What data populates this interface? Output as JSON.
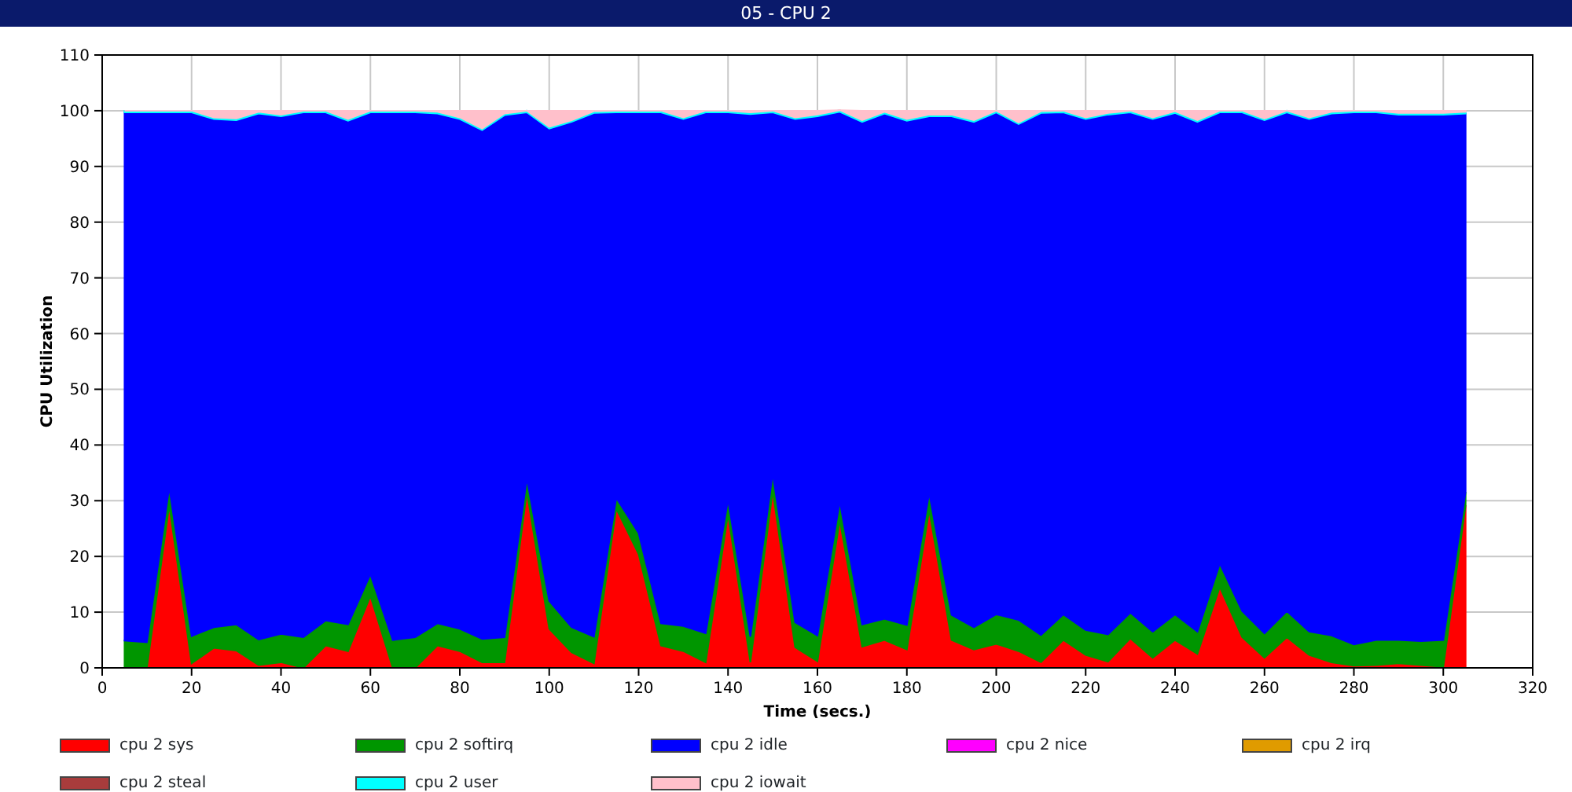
{
  "window": {
    "title": "05 - CPU 2"
  },
  "chart": {
    "chart_data": {
      "type": "area",
      "stacked": true,
      "grid": true,
      "xlabel": "Time (secs.)",
      "ylabel": "CPU Utilization",
      "x": [
        5,
        10,
        15,
        20,
        25,
        30,
        35,
        40,
        45,
        50,
        55,
        60,
        65,
        70,
        75,
        80,
        85,
        90,
        95,
        100,
        105,
        110,
        115,
        120,
        125,
        130,
        135,
        140,
        145,
        150,
        155,
        160,
        165,
        170,
        175,
        180,
        185,
        190,
        195,
        200,
        205,
        210,
        215,
        220,
        225,
        230,
        235,
        240,
        245,
        250,
        255,
        260,
        265,
        270,
        275,
        280,
        285,
        290,
        295,
        300,
        305
      ],
      "xlim": [
        0,
        320
      ],
      "ylim": [
        0,
        110
      ],
      "xticks": [
        0,
        20,
        40,
        60,
        80,
        100,
        120,
        140,
        160,
        180,
        200,
        220,
        240,
        260,
        280,
        300,
        320
      ],
      "yticks": [
        0,
        10,
        20,
        30,
        40,
        50,
        60,
        70,
        80,
        90,
        100,
        110
      ],
      "series": [
        {
          "name": "cpu 2 sys",
          "color": "#ff0000",
          "values": [
            0,
            0,
            29.2,
            0.8,
            3.6,
            3.1,
            0.5,
            1.0,
            0,
            4.0,
            3.0,
            12.9,
            0,
            0,
            4.0,
            3.0,
            1.0,
            1.0,
            31.6,
            7.0,
            2.8,
            0.8,
            28.6,
            20.4,
            4.0,
            3.0,
            1.0,
            27.6,
            1.0,
            31.8,
            3.7,
            1.2,
            26.5,
            3.8,
            5.0,
            3.3,
            28.3,
            5.0,
            3.3,
            4.3,
            3.0,
            1.0,
            5.0,
            2.3,
            1.1,
            5.3,
            1.8,
            5.0,
            2.5,
            14.5,
            5.5,
            1.8,
            5.5,
            2.3,
            1.0,
            0.4,
            0.5,
            0.8,
            0.5,
            0.2,
            29.2
          ]
        },
        {
          "name": "cpu 2 softirq",
          "color": "#009600",
          "values": [
            4.9,
            4.6,
            3.2,
            4.9,
            3.7,
            4.7,
            4.6,
            5.1,
            5.5,
            4.5,
            4.8,
            3.9,
            5.0,
            5.5,
            4.0,
            4.0,
            4.2,
            4.5,
            2.4,
            5.0,
            4.5,
            4.8,
            1.9,
            3.8,
            4.0,
            4.5,
            5.2,
            2.6,
            4.6,
            3.1,
            4.5,
            4.6,
            3.4,
            4.0,
            3.8,
            4.4,
            3.1,
            4.5,
            4.0,
            5.3,
            5.6,
            4.9,
            4.6,
            4.5,
            4.9,
            4.6,
            4.7,
            4.6,
            4.0,
            4.2,
            4.7,
            4.4,
            4.7,
            4.2,
            4.8,
            3.8,
            4.5,
            4.2,
            4.3,
            4.8,
            2.4
          ]
        },
        {
          "name": "cpu 2 idle",
          "color": "#0000ff",
          "values": [
            94.8,
            95.1,
            67.3,
            94.0,
            91.2,
            90.5,
            94.4,
            92.9,
            94.2,
            91.2,
            90.4,
            82.9,
            94.7,
            94.2,
            91.5,
            91.5,
            91.3,
            93.7,
            65.7,
            84.8,
            90.7,
            94.0,
            69.2,
            75.5,
            91.7,
            91.0,
            93.5,
            69.5,
            93.8,
            64.8,
            90.3,
            93.2,
            69.9,
            90.2,
            90.7,
            90.5,
            67.6,
            89.5,
            90.7,
            90.1,
            89.0,
            93.7,
            90.1,
            91.7,
            93.3,
            89.8,
            92.0,
            90.0,
            91.5,
            81.0,
            89.5,
            92.1,
            89.5,
            92.0,
            93.7,
            95.5,
            94.7,
            94.3,
            94.5,
            94.3,
            67.9
          ]
        },
        {
          "name": "cpu 2 nice",
          "color": "#ff00ff",
          "values": [
            null,
            null,
            null,
            null,
            null,
            null,
            null,
            null,
            null,
            null,
            null,
            null,
            null,
            null,
            null,
            null,
            null,
            null,
            null,
            null,
            null,
            null,
            null,
            null,
            null,
            null,
            null,
            null,
            null,
            null,
            null,
            null,
            null,
            null,
            null,
            null,
            null,
            null,
            null,
            null,
            null,
            null,
            null,
            null,
            null,
            null,
            null,
            null,
            null,
            null,
            null,
            null,
            null,
            null,
            null,
            null,
            null,
            null,
            null,
            null,
            null
          ]
        },
        {
          "name": "cpu 2 irq",
          "color": "#e09b00",
          "values": [
            null,
            null,
            null,
            null,
            null,
            null,
            null,
            null,
            null,
            null,
            null,
            null,
            null,
            null,
            null,
            null,
            null,
            null,
            null,
            null,
            null,
            null,
            null,
            null,
            null,
            null,
            null,
            null,
            null,
            null,
            null,
            null,
            null,
            null,
            null,
            null,
            null,
            null,
            null,
            null,
            null,
            null,
            null,
            null,
            null,
            null,
            null,
            null,
            null,
            null,
            null,
            null,
            null,
            null,
            null,
            null,
            null,
            null,
            null,
            null,
            null
          ]
        },
        {
          "name": "cpu 2 steal",
          "color": "#a83c3c",
          "values": [
            null,
            null,
            null,
            null,
            null,
            null,
            null,
            null,
            null,
            null,
            null,
            null,
            null,
            null,
            null,
            null,
            null,
            null,
            null,
            null,
            null,
            null,
            null,
            null,
            null,
            null,
            null,
            null,
            null,
            null,
            null,
            null,
            null,
            null,
            null,
            null,
            null,
            null,
            null,
            null,
            null,
            null,
            null,
            null,
            null,
            null,
            null,
            null,
            null,
            null,
            null,
            null,
            null,
            null,
            null,
            null,
            null,
            null,
            null,
            null,
            null
          ]
        },
        {
          "name": "cpu 2 user",
          "color": "#00ffff",
          "values": [
            0.3,
            0.3,
            0.3,
            0.3,
            0.3,
            0.3,
            0.3,
            0.3,
            0.3,
            0.3,
            0.3,
            0.3,
            0.3,
            0.3,
            0.3,
            0.3,
            0.3,
            0.3,
            0.3,
            0.3,
            0.3,
            0.3,
            0.3,
            0.3,
            0.3,
            0.3,
            0.3,
            0.3,
            0.3,
            0.3,
            0.3,
            0.3,
            0.3,
            0.3,
            0.3,
            0.3,
            0.3,
            0.3,
            0.3,
            0.3,
            0.3,
            0.3,
            0.3,
            0.3,
            0.3,
            0.3,
            0.3,
            0.3,
            0.3,
            0.3,
            0.3,
            0.3,
            0.3,
            0.3,
            0.3,
            0.3,
            0.3,
            0.3,
            0.3,
            0.3,
            0.3
          ]
        },
        {
          "name": "cpu 2 iowait",
          "color": "#ffc0cb",
          "values": [
            0,
            0,
            0,
            0,
            1.2,
            1.4,
            0.2,
            0.7,
            0,
            0,
            1.5,
            0,
            0,
            0,
            0.2,
            1.2,
            3.2,
            0.5,
            0,
            2.9,
            1.7,
            0.1,
            0,
            0,
            0,
            1.2,
            0,
            0,
            0.3,
            0,
            1.2,
            0.7,
            0,
            1.7,
            0.2,
            1.5,
            0.7,
            0.7,
            1.7,
            0,
            2.1,
            0.1,
            0,
            1.2,
            0.4,
            0,
            1.2,
            0.1,
            1.7,
            0,
            0,
            1.4,
            0,
            1.2,
            0.2,
            0,
            0,
            0.4,
            0.4,
            0.4,
            0.2
          ]
        }
      ]
    }
  }
}
